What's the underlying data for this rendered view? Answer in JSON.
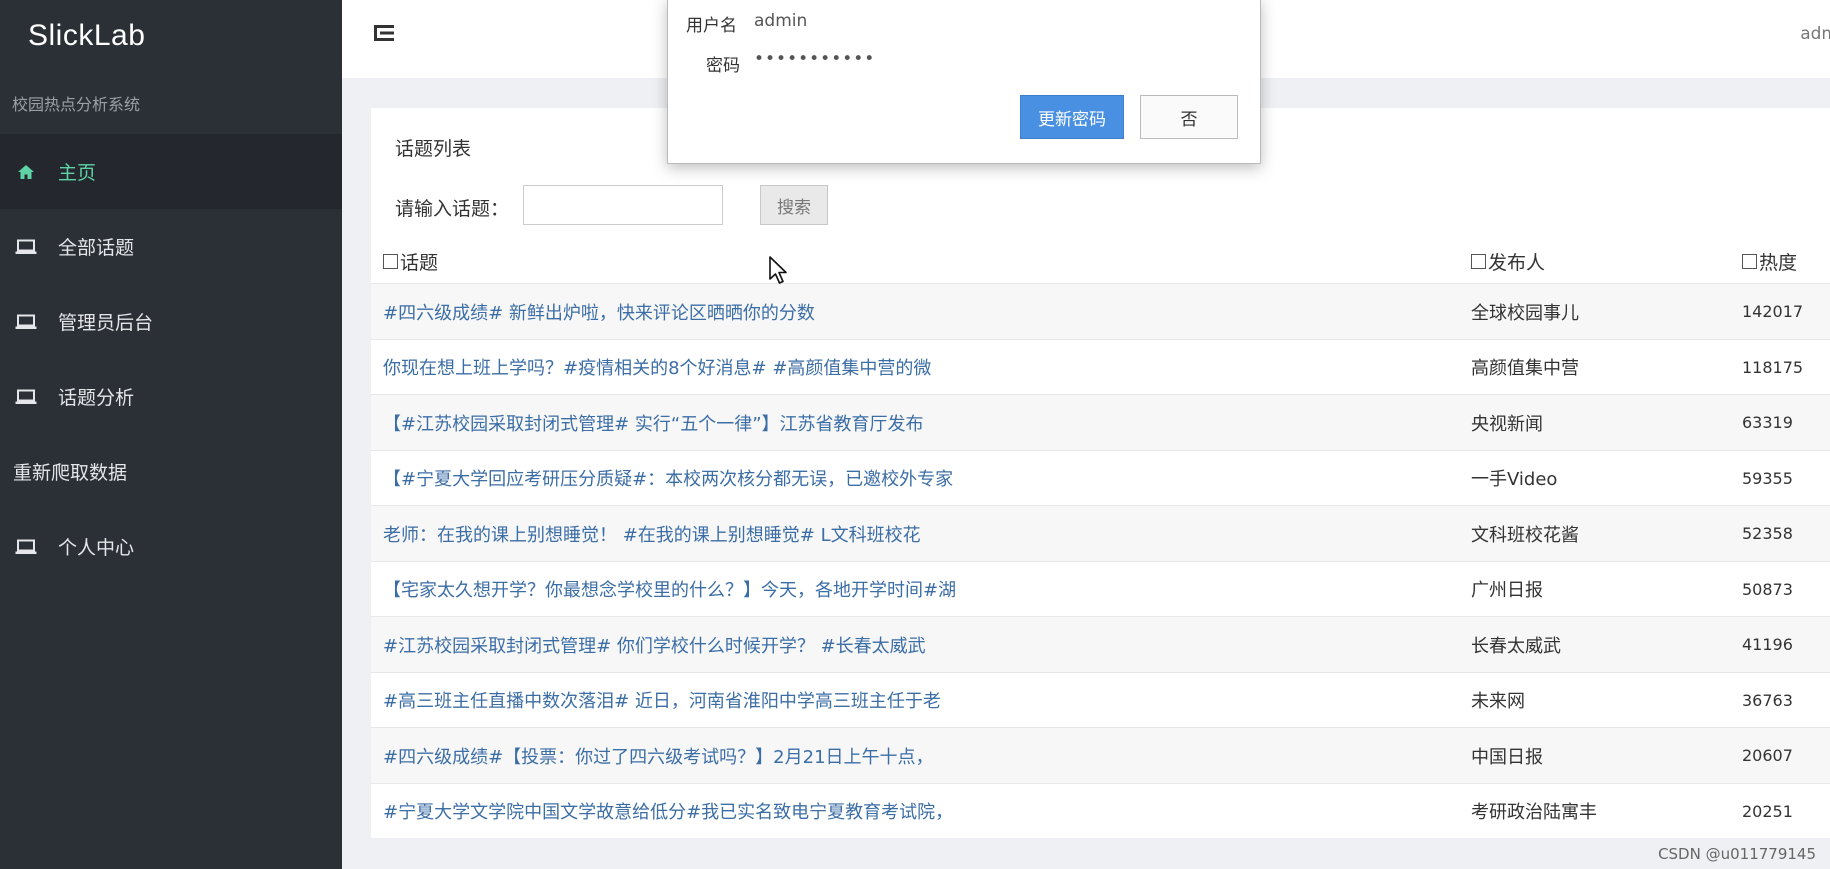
{
  "sidebar": {
    "brand": "SlickLab",
    "subtitle": "校园热点分析系统",
    "items": [
      {
        "label": "主页",
        "icon": "home-icon",
        "active": true
      },
      {
        "label": "全部话题",
        "icon": "laptop-icon"
      },
      {
        "label": "管理员后台",
        "icon": "laptop-icon"
      },
      {
        "label": "话题分析",
        "icon": "laptop-icon"
      },
      {
        "label": "重新爬取数据",
        "icon": ""
      },
      {
        "label": "个人中心",
        "icon": "laptop-icon"
      }
    ]
  },
  "header": {
    "menu_icon": "menu-toggle-icon",
    "user": "adm"
  },
  "dialog": {
    "username_label": "用户名",
    "username_value": "admin",
    "password_label": "密码",
    "password_value": "•••••••••••",
    "confirm_label": "更新密码",
    "cancel_label": "否"
  },
  "panel": {
    "title": "话题列表",
    "search_label": "请输入话题：",
    "search_value": "",
    "search_button": "搜索",
    "columns": [
      "话题",
      "发布人",
      "热度"
    ],
    "rows": [
      {
        "topic": "#四六级成绩# 新鲜出炉啦，快来评论区晒晒你的分数",
        "author": "全球校园事儿",
        "heat": "142017"
      },
      {
        "topic": "你现在想上班上学吗？#疫情相关的8个好消息# #高颜值集中营的微",
        "author": "高颜值集中营",
        "heat": "118175"
      },
      {
        "topic": "【#江苏校园采取封闭式管理# 实行“五个一律”】江苏省教育厅发布",
        "author": "央视新闻",
        "heat": "63319"
      },
      {
        "topic": "【#宁夏大学回应考研压分质疑#：本校两次核分都无误，已邀校外专家",
        "author": "一手Video",
        "heat": "59355"
      },
      {
        "topic": "老师：在我的课上别想睡觉！ #在我的课上别想睡觉# L文科班校花",
        "author": "文科班校花酱",
        "heat": "52358"
      },
      {
        "topic": "【宅家太久想开学？你最想念学校里的什么？】今天，各地开学时间#湖",
        "author": "广州日报",
        "heat": "50873"
      },
      {
        "topic": "#江苏校园采取封闭式管理# 你们学校什么时候开学？ #长春太威武",
        "author": "长春太威武",
        "heat": "41196"
      },
      {
        "topic": "#高三班主任直播中数次落泪# 近日，河南省淮阳中学高三班主任于老",
        "author": "未来网",
        "heat": "36763"
      },
      {
        "topic": "#四六级成绩#【投票：你过了四六级考试吗？】2月21日上午十点，",
        "author": "中国日报",
        "heat": "20607"
      },
      {
        "topic": "#宁夏大学文学院中国文学故意给低分#我已实名致电宁夏教育考试院，",
        "author": "考研政治陆寓丰",
        "heat": "20251"
      }
    ]
  },
  "colors": {
    "sidebar_bg": "#2b2f36",
    "active_accent": "#5fd3a6",
    "link": "#3c6ea6",
    "primary_button": "#4a90e2"
  },
  "watermark": "CSDN @u011779145"
}
